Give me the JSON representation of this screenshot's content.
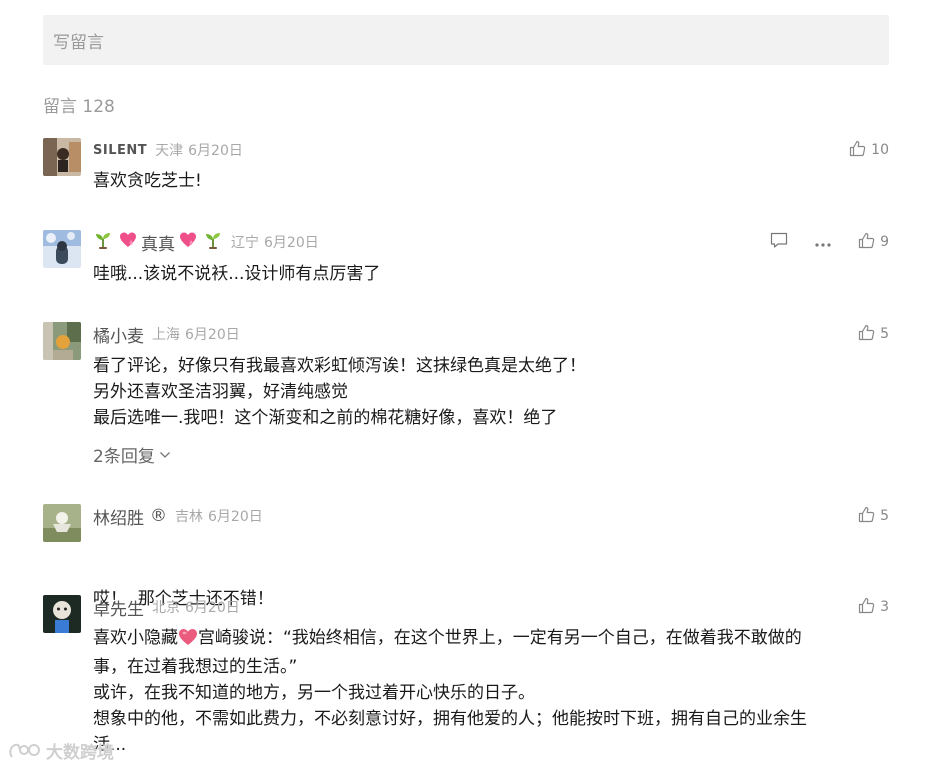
{
  "compose": {
    "placeholder": "写留言"
  },
  "header": {
    "count_label": "留言 128"
  },
  "comments": [
    {
      "nickname": "SILENT",
      "region": "天津",
      "date": "6月20日",
      "likes": "10",
      "lines": [
        "喜欢贪吃芝士!"
      ]
    },
    {
      "nickname": "真真",
      "region": "辽宁",
      "date": "6月20日",
      "likes": "9",
      "lines": [
        "哇哦...该说不说袄...设计师有点厉害了"
      ]
    },
    {
      "nickname": "橘小麦",
      "region": "上海",
      "date": "6月20日",
      "likes": "5",
      "lines": [
        "看了评论，好像只有我最喜欢彩虹倾泻诶！这抹绿色真是太绝了！",
        "另外还喜欢圣洁羽翼，好清纯感觉",
        "最后选唯一.我吧！这个渐变和之前的棉花糖好像，喜欢！绝了"
      ],
      "replies_label": "2条回复"
    },
    {
      "nickname": "林绍胜",
      "nickname_mark": "®",
      "region": "吉林",
      "date": "6月20日",
      "likes": "5",
      "lines": [
        "哎！  那个芝士还不错！"
      ]
    },
    {
      "nickname": "卓先生",
      "region": "北京",
      "date": "6月20日",
      "likes": "3",
      "line1_pre": "喜欢小隐藏",
      "line1_post": "宫崎骏说：“我始终相信，在这个世界上，一定有另一个自己，在做着我不敢做的",
      "lines": [
        "事，在过着我想过的生活。”",
        "或许，在我不知道的地方，另一个我过着开心快乐的日子。",
        "想象中的他，不需如此费力，不必刻意讨好，拥有他爱的人；他能按时下班，拥有自己的业余生",
        "活..."
      ]
    }
  ],
  "watermark": {
    "text": "大数跨境"
  },
  "icons": [
    "thumb-up-icon",
    "comment-icon",
    "more-icon",
    "chevron-down-icon",
    "sprout-icon",
    "heart-icon"
  ],
  "colors": {
    "input_bg": "#f2f2f2",
    "muted": "#a8a8a8",
    "text": "#1a1a1a",
    "heart": "#e8557a"
  }
}
